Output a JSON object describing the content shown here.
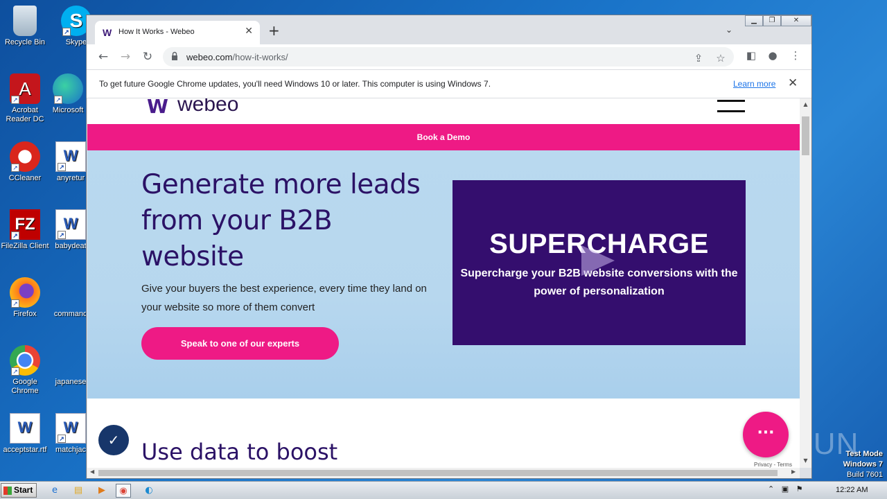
{
  "desktop": {
    "icons": [
      {
        "label": "Recycle Bin"
      },
      {
        "label": "Skype"
      },
      {
        "label": "Acrobat Reader DC"
      },
      {
        "label": "Microsoft"
      },
      {
        "label": "CCleaner"
      },
      {
        "label": "anyretur"
      },
      {
        "label": "FileZilla Client"
      },
      {
        "label": "babydeat"
      },
      {
        "label": "Firefox"
      },
      {
        "label": "command"
      },
      {
        "label": "Google Chrome"
      },
      {
        "label": "japanese"
      },
      {
        "label": "acceptstar.rtf"
      },
      {
        "label": "matchjac"
      }
    ],
    "watermark": "ANY.RUN",
    "test_mode": {
      "line1": "Test Mode",
      "line2": "Windows 7",
      "line3": "Build 7601"
    }
  },
  "browser": {
    "tab": {
      "title": "How It Works - Webeo",
      "favicon": "W"
    },
    "url": {
      "host": "webeo.com",
      "path": "/how-it-works/"
    },
    "infobar": {
      "message": "To get future Google Chrome updates, you'll need Windows 10 or later. This computer is using Windows 7.",
      "link": "Learn more"
    }
  },
  "page": {
    "logo": "webeo",
    "demo_bar": "Book a Demo",
    "hero": {
      "heading": "Generate more leads from your B2B website",
      "body": "Give your buyers the best experience, every time they land on your website so more of them convert",
      "cta": "Speak to one of our experts"
    },
    "video": {
      "title": "SUPERCHARGE",
      "subtitle": "Supercharge your B2B website conversions with the power of personalization"
    },
    "section2": {
      "heading": "Use data to boost"
    },
    "recaptcha": "Privacy - Terms"
  },
  "taskbar": {
    "start": "Start",
    "clock": "12:22 AM"
  },
  "colors": {
    "brand_pink": "#ee1a85",
    "brand_purple": "#340e6e",
    "hero_bg": "#b9d9ef"
  }
}
